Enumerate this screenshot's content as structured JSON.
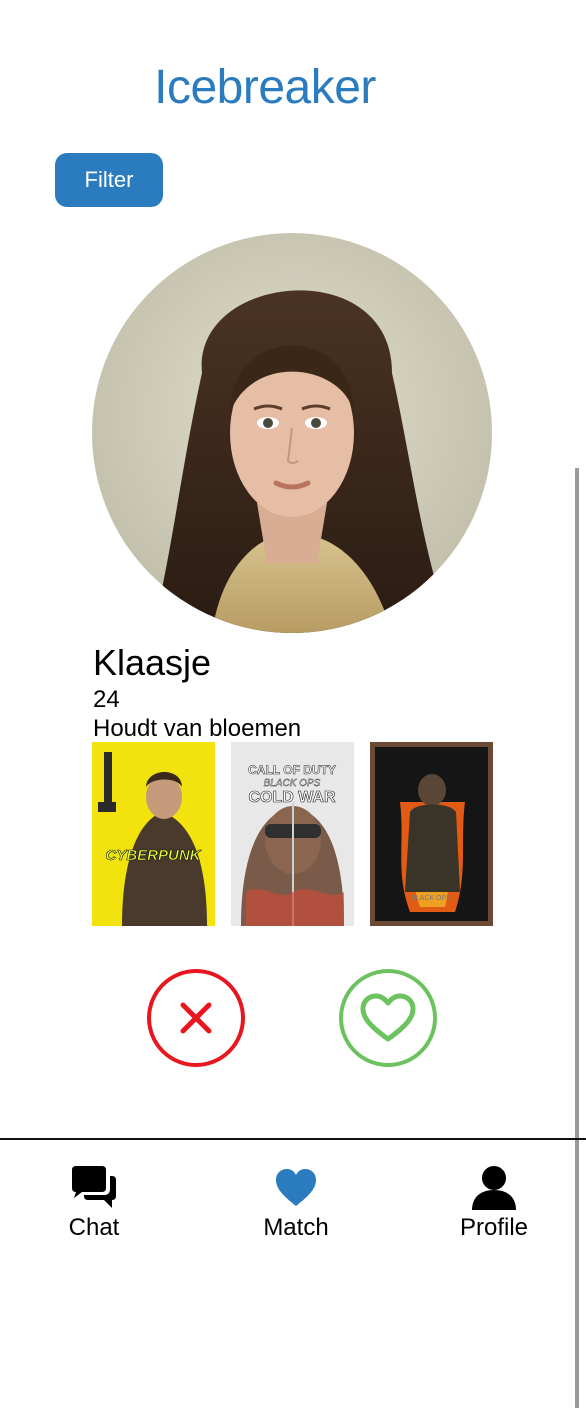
{
  "header": {
    "title": "Icebreaker"
  },
  "filter": {
    "label": "Filter"
  },
  "profile_card": {
    "name": "Klaasje",
    "age": "24",
    "bio": "Houdt van bloemen",
    "games": [
      {
        "title": "CYBERPUNK"
      },
      {
        "title_line1": "CALL OF DUTY",
        "title_line2": "BLACK OPS",
        "title_line3": "COLD WAR"
      },
      {
        "title": "BLACK OPS"
      }
    ]
  },
  "actions": {
    "reject_icon": "close-icon",
    "like_icon": "heart-outline-icon"
  },
  "bottom_nav": {
    "items": [
      {
        "label": "Chat",
        "icon": "chat-bubbles-icon"
      },
      {
        "label": "Match",
        "icon": "heart-icon",
        "active": true
      },
      {
        "label": "Profile",
        "icon": "person-icon"
      }
    ]
  },
  "colors": {
    "accent": "#2b7bbf",
    "reject": "#e8161e",
    "like": "#6cc25f"
  }
}
